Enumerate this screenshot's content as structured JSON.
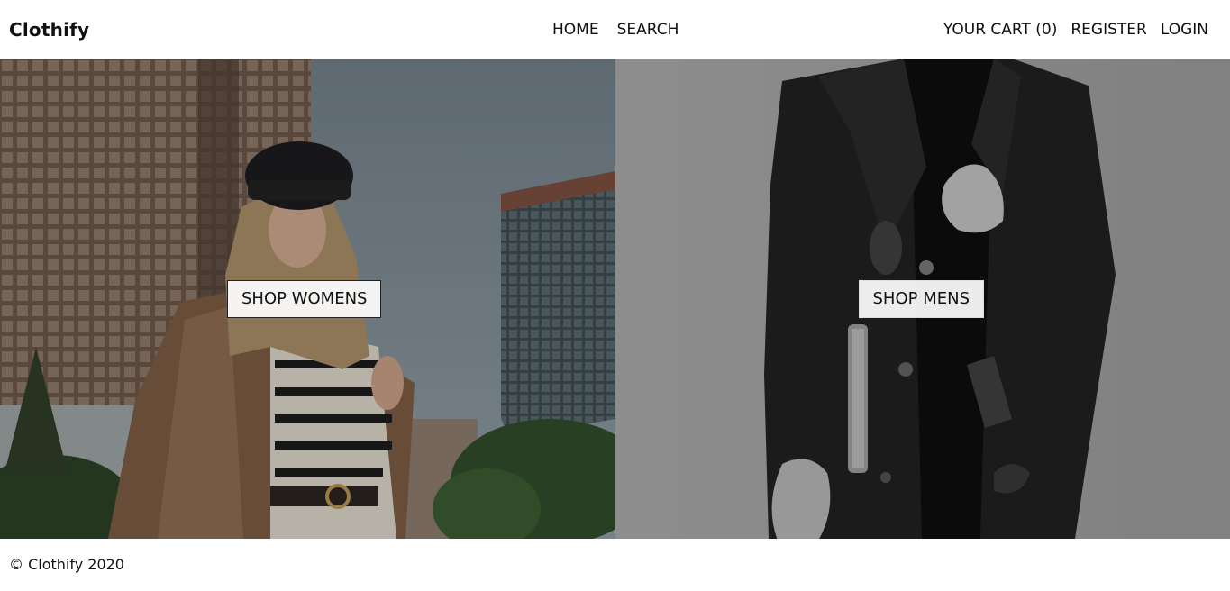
{
  "header": {
    "logo": "Clothify",
    "nav_center": [
      {
        "label": "HOME"
      },
      {
        "label": "SEARCH"
      }
    ],
    "nav_right": {
      "cart_label": "YOUR CART (0)",
      "register_label": "REGISTER",
      "login_label": "LOGIN"
    }
  },
  "hero": {
    "women": {
      "button_label": "SHOP WOMENS"
    },
    "men": {
      "button_label": "SHOP MENS"
    }
  },
  "footer": {
    "copyright": "© Clothify 2020"
  }
}
